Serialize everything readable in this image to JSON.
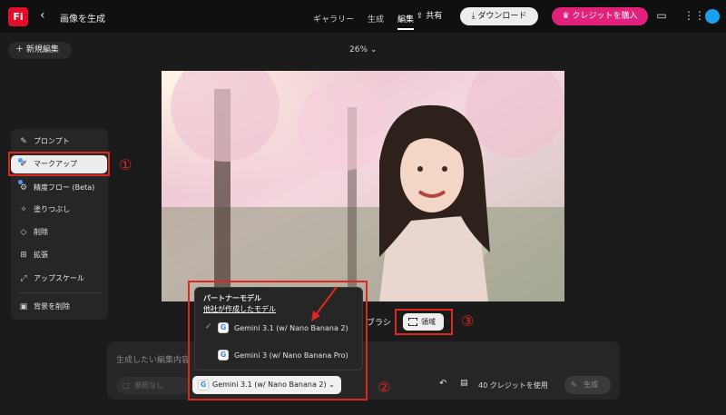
{
  "topbar": {
    "logo": "Fi",
    "back_icon": "chevron-left-icon",
    "title": "画像を生成",
    "tabs": [
      "ギャラリー",
      "生成",
      "編集"
    ],
    "active_tab": "編集",
    "share_label": "共有",
    "download_label": "ダウンロード",
    "buy_credits_label": "クレジットを購入",
    "colors": {
      "buy": "#e2217c",
      "logo": "#e10d2a",
      "avatar": "#19a1f0"
    }
  },
  "toolbar": {
    "new_edit_label": "新規編集",
    "zoom": "26%"
  },
  "tools": [
    {
      "label": "プロンプト",
      "icon": "prompt-icon"
    },
    {
      "label": "マークアップ",
      "icon": "markup-icon",
      "selected": true
    },
    {
      "label": "精度フロー (Beta)",
      "icon": "flow-icon"
    },
    {
      "label": "塗りつぶし",
      "icon": "fill-icon"
    },
    {
      "label": "削除",
      "icon": "eraser-icon"
    },
    {
      "label": "拡張",
      "icon": "expand-icon"
    },
    {
      "label": "アップスケール",
      "icon": "upscale-icon"
    },
    {
      "label": "背景を削除",
      "icon": "remove-bg-icon"
    }
  ],
  "annotations": [
    "①",
    "②",
    "③"
  ],
  "model_menu": {
    "heading": "パートナーモデル",
    "subheading": "他社が作成したモデル",
    "options": [
      {
        "label": "Gemini 3.1 (w/ Nano Banana 2)",
        "checked": true
      },
      {
        "label": "Gemini 3 (w/ Nano Banana Pro)",
        "checked": false
      }
    ]
  },
  "selection_tools": {
    "brush_label": "ブラシ",
    "region_label": "領域"
  },
  "prompt": {
    "placeholder": "生成したい編集内容",
    "style_label": "参照なし",
    "model_selected": "Gemini 3.1 (w/ Nano Banana 2)",
    "credit_text": "40 クレジットを使用",
    "generate_label": "生成"
  }
}
